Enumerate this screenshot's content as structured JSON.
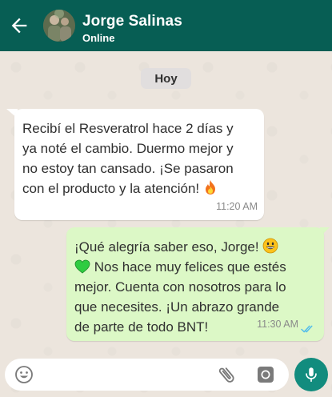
{
  "header": {
    "contact_name": "Jorge Salinas",
    "status": "Online",
    "icons": {
      "back": "arrow-left-icon",
      "avatar": "contact-photo"
    }
  },
  "chat": {
    "date_chip": "Hoy",
    "messages": [
      {
        "direction": "incoming",
        "lines": [
          "Recibí el Resveratrol hace 2 días y",
          "ya noté el cambio. Duermo mejor y",
          "no estoy tan cansado. ¡Se pasaron",
          "con el producto y la atención!"
        ],
        "emoji": "fire-emoji",
        "time": "11:20 AM"
      },
      {
        "direction": "outgoing",
        "lines": [
          "¡Qué alegría saber eso, Jorge!",
          "Nos hace muy felices que estés",
          "mejor. Cuenta con nosotros para lo",
          "que necesites. ¡Un abrazo grande",
          "de parte de todo BNT!"
        ],
        "emojis": [
          "grinning-face-emoji",
          "green-heart-emoji"
        ],
        "time": "11:30 AM",
        "read_receipt": "double-check-read-icon"
      }
    ]
  },
  "composer": {
    "placeholder": "",
    "icons": [
      "emoji-icon",
      "paperclip-icon",
      "camera-icon",
      "microphone-icon"
    ]
  },
  "colors": {
    "header": "#075e54",
    "chat_background": "#ece5dd",
    "incoming_bubble": "#ffffff",
    "outgoing_bubble": "#dcf8c6",
    "mic_button": "#128c7e",
    "read_ticks": "#53bdeb"
  }
}
